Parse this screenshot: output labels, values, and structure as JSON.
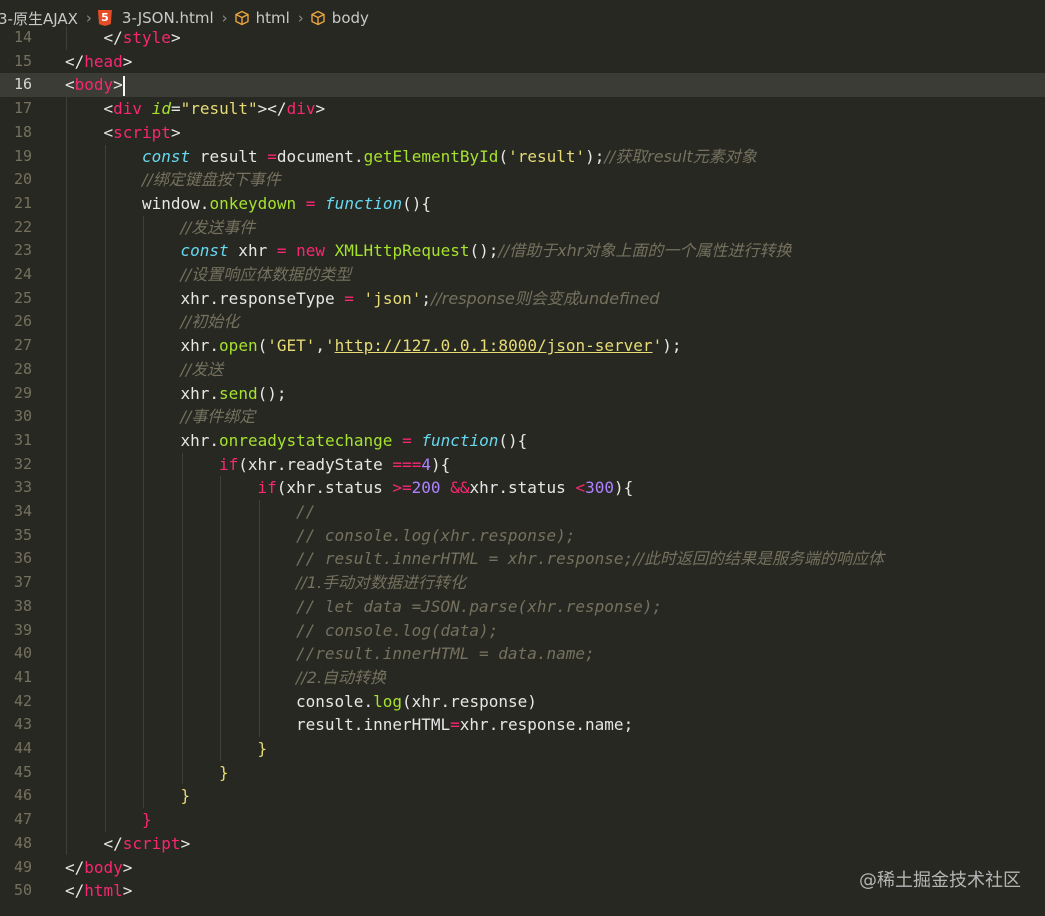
{
  "breadcrumb": {
    "folder": "3-原生AJAX",
    "file": "3-JSON.html",
    "node1": "html",
    "node2": "body",
    "file_icon_letter": "5"
  },
  "watermark": "@稀土掘金技术社区",
  "current_line": 16,
  "lines": [
    {
      "n": "14",
      "indent": 1,
      "tokens": [
        [
          "punc",
          "</"
        ],
        [
          "tag",
          "style"
        ],
        [
          "punc",
          ">"
        ]
      ]
    },
    {
      "n": "15",
      "indent": 0,
      "tokens": [
        [
          "punc",
          "</"
        ],
        [
          "tag",
          "head"
        ],
        [
          "punc",
          ">"
        ]
      ]
    },
    {
      "n": "16",
      "indent": 0,
      "tokens": [
        [
          "punc",
          "<"
        ],
        [
          "tag",
          "body"
        ],
        [
          "punc",
          ">"
        ]
      ]
    },
    {
      "n": "17",
      "indent": 1,
      "tokens": [
        [
          "punc",
          "<"
        ],
        [
          "tag",
          "div"
        ],
        [
          "punc",
          " "
        ],
        [
          "attr",
          "id"
        ],
        [
          "punc",
          "="
        ],
        [
          "str",
          "\"result\""
        ],
        [
          "punc",
          "></"
        ],
        [
          "tag",
          "div"
        ],
        [
          "punc",
          ">"
        ]
      ]
    },
    {
      "n": "18",
      "indent": 1,
      "tokens": [
        [
          "punc",
          "<"
        ],
        [
          "tag",
          "script"
        ],
        [
          "punc",
          ">"
        ]
      ]
    },
    {
      "n": "19",
      "indent": 2,
      "tokens": [
        [
          "kw",
          "const"
        ],
        [
          "var",
          " result "
        ],
        [
          "op",
          "="
        ],
        [
          "var",
          "document"
        ],
        [
          "punc",
          "."
        ],
        [
          "prop",
          "getElementById"
        ],
        [
          "punc",
          "("
        ],
        [
          "str",
          "'result'"
        ],
        [
          "punc",
          ");"
        ],
        [
          "cmt",
          "//获取result元素对象"
        ]
      ]
    },
    {
      "n": "20",
      "indent": 2,
      "tokens": [
        [
          "cmt",
          "//绑定键盘按下事件"
        ]
      ]
    },
    {
      "n": "21",
      "indent": 2,
      "tokens": [
        [
          "var",
          "window"
        ],
        [
          "punc",
          "."
        ],
        [
          "prop",
          "onkeydown"
        ],
        [
          "op",
          " = "
        ],
        [
          "fn",
          "function"
        ],
        [
          "punc",
          "(){"
        ]
      ]
    },
    {
      "n": "22",
      "indent": 3,
      "tokens": [
        [
          "cmt",
          "//发送事件"
        ]
      ]
    },
    {
      "n": "23",
      "indent": 3,
      "tokens": [
        [
          "kw",
          "const"
        ],
        [
          "var",
          " xhr "
        ],
        [
          "op",
          "="
        ],
        [
          "kwd",
          " new "
        ],
        [
          "cls",
          "XMLHttpRequest"
        ],
        [
          "punc",
          "();"
        ],
        [
          "cmt",
          "//借助于xhr对象上面的一个属性进行转换"
        ]
      ]
    },
    {
      "n": "24",
      "indent": 3,
      "tokens": [
        [
          "cmt",
          "//设置响应体数据的类型"
        ]
      ]
    },
    {
      "n": "25",
      "indent": 3,
      "tokens": [
        [
          "var",
          "xhr"
        ],
        [
          "punc",
          "."
        ],
        [
          "var",
          "responseType "
        ],
        [
          "op",
          "="
        ],
        [
          "str",
          " 'json'"
        ],
        [
          "punc",
          ";"
        ],
        [
          "cmt",
          "//response则会变成undefined"
        ]
      ]
    },
    {
      "n": "26",
      "indent": 3,
      "tokens": [
        [
          "cmt",
          "//初始化"
        ]
      ]
    },
    {
      "n": "27",
      "indent": 3,
      "tokens": [
        [
          "var",
          "xhr"
        ],
        [
          "punc",
          "."
        ],
        [
          "prop",
          "open"
        ],
        [
          "punc",
          "("
        ],
        [
          "str",
          "'GET'"
        ],
        [
          "punc",
          ","
        ],
        [
          "str",
          "'"
        ],
        [
          "url",
          "http://127.0.0.1:8000/json-server"
        ],
        [
          "str",
          "'"
        ],
        [
          "punc",
          ");"
        ]
      ]
    },
    {
      "n": "28",
      "indent": 3,
      "tokens": [
        [
          "cmt",
          "//发送"
        ]
      ]
    },
    {
      "n": "29",
      "indent": 3,
      "tokens": [
        [
          "var",
          "xhr"
        ],
        [
          "punc",
          "."
        ],
        [
          "prop",
          "send"
        ],
        [
          "punc",
          "();"
        ]
      ]
    },
    {
      "n": "30",
      "indent": 3,
      "tokens": [
        [
          "cmt",
          "//事件绑定"
        ]
      ]
    },
    {
      "n": "31",
      "indent": 3,
      "tokens": [
        [
          "var",
          "xhr"
        ],
        [
          "punc",
          "."
        ],
        [
          "prop",
          "onreadystatechange"
        ],
        [
          "op",
          " = "
        ],
        [
          "fn",
          "function"
        ],
        [
          "punc",
          "(){"
        ]
      ]
    },
    {
      "n": "32",
      "indent": 4,
      "tokens": [
        [
          "kwd",
          "if"
        ],
        [
          "punc",
          "("
        ],
        [
          "var",
          "xhr"
        ],
        [
          "punc",
          "."
        ],
        [
          "var",
          "readyState "
        ],
        [
          "op",
          "==="
        ],
        [
          "num",
          "4"
        ],
        [
          "punc",
          "){"
        ]
      ]
    },
    {
      "n": "33",
      "indent": 5,
      "tokens": [
        [
          "kwd",
          "if"
        ],
        [
          "punc",
          "("
        ],
        [
          "var",
          "xhr"
        ],
        [
          "punc",
          "."
        ],
        [
          "var",
          "status "
        ],
        [
          "op",
          ">="
        ],
        [
          "num",
          "200"
        ],
        [
          "op",
          " &&"
        ],
        [
          "var",
          "xhr"
        ],
        [
          "punc",
          "."
        ],
        [
          "var",
          "status "
        ],
        [
          "op",
          "<"
        ],
        [
          "num",
          "300"
        ],
        [
          "punc",
          "){"
        ]
      ]
    },
    {
      "n": "34",
      "indent": 6,
      "tokens": [
        [
          "cmtm",
          "//"
        ]
      ]
    },
    {
      "n": "35",
      "indent": 6,
      "tokens": [
        [
          "cmtm",
          "// console.log(xhr.response);"
        ]
      ]
    },
    {
      "n": "36",
      "indent": 6,
      "tokens": [
        [
          "cmtm",
          "// result.innerHTML = xhr.response;"
        ],
        [
          "cmt",
          "//此时返回的结果是服务端的响应体"
        ]
      ]
    },
    {
      "n": "37",
      "indent": 6,
      "tokens": [
        [
          "cmt",
          "//1.手动对数据进行转化"
        ]
      ]
    },
    {
      "n": "38",
      "indent": 6,
      "tokens": [
        [
          "cmtm",
          "// let data =JSON.parse(xhr.response);"
        ]
      ]
    },
    {
      "n": "39",
      "indent": 6,
      "tokens": [
        [
          "cmtm",
          "// console.log(data);"
        ]
      ]
    },
    {
      "n": "40",
      "indent": 6,
      "tokens": [
        [
          "cmtm",
          "//result.innerHTML = data.name;"
        ]
      ]
    },
    {
      "n": "41",
      "indent": 6,
      "tokens": [
        [
          "cmt",
          "//2.自动转换"
        ]
      ]
    },
    {
      "n": "42",
      "indent": 6,
      "tokens": [
        [
          "var",
          "console"
        ],
        [
          "punc",
          "."
        ],
        [
          "prop",
          "log"
        ],
        [
          "punc",
          "("
        ],
        [
          "var",
          "xhr"
        ],
        [
          "punc",
          "."
        ],
        [
          "var",
          "response"
        ],
        [
          "punc",
          ")"
        ]
      ]
    },
    {
      "n": "43",
      "indent": 6,
      "tokens": [
        [
          "var",
          "result"
        ],
        [
          "punc",
          "."
        ],
        [
          "var",
          "innerHTML"
        ],
        [
          "op",
          "="
        ],
        [
          "var",
          "xhr"
        ],
        [
          "punc",
          "."
        ],
        [
          "var",
          "response"
        ],
        [
          "punc",
          "."
        ],
        [
          "var",
          "name"
        ],
        [
          "punc",
          ";"
        ]
      ]
    },
    {
      "n": "44",
      "indent": 5,
      "tokens": [
        [
          "str",
          "}"
        ]
      ]
    },
    {
      "n": "45",
      "indent": 4,
      "tokens": [
        [
          "str",
          "}"
        ]
      ]
    },
    {
      "n": "46",
      "indent": 3,
      "tokens": [
        [
          "str",
          "}"
        ]
      ]
    },
    {
      "n": "47",
      "indent": 2,
      "tokens": [
        [
          "op",
          "}"
        ]
      ]
    },
    {
      "n": "48",
      "indent": 1,
      "tokens": [
        [
          "punc",
          "</"
        ],
        [
          "tag",
          "script"
        ],
        [
          "punc",
          ">"
        ]
      ]
    },
    {
      "n": "49",
      "indent": 0,
      "tokens": [
        [
          "punc",
          "</"
        ],
        [
          "tag",
          "body"
        ],
        [
          "punc",
          ">"
        ]
      ]
    },
    {
      "n": "50",
      "indent": 0,
      "tokens": [
        [
          "punc",
          "</"
        ],
        [
          "tag",
          "html"
        ],
        [
          "punc",
          ">"
        ]
      ]
    }
  ]
}
